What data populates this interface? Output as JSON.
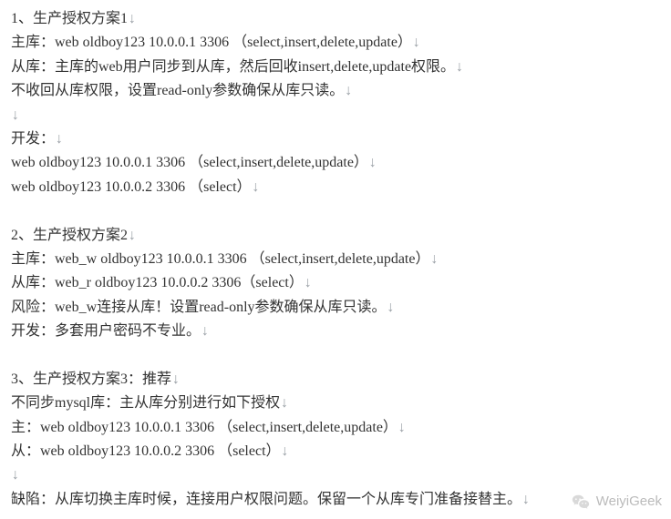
{
  "ret": "↓",
  "lines": [
    {
      "text": "1、生产授权方案1"
    },
    {
      "text": "主库：web oldboy123 10.0.0.1 3306 （select,insert,delete,update）"
    },
    {
      "text": "从库：主库的web用户同步到从库，然后回收insert,delete,update权限。"
    },
    {
      "text": "不收回从库权限，设置read-only参数确保从库只读。"
    },
    {
      "text": ""
    },
    {
      "text": "开发："
    },
    {
      "text": "web oldboy123 10.0.0.1 3306 （select,insert,delete,update）"
    },
    {
      "text": "web oldboy123 10.0.0.2 3306 （select）"
    },
    {
      "blank": true
    },
    {
      "text": "2、生产授权方案2"
    },
    {
      "text": "主库：web_w oldboy123 10.0.0.1 3306 （select,insert,delete,update）"
    },
    {
      "text": "从库：web_r oldboy123 10.0.0.2 3306（select）"
    },
    {
      "text": "风险：web_w连接从库！设置read-only参数确保从库只读。"
    },
    {
      "text": "开发：多套用户密码不专业。"
    },
    {
      "blank": true
    },
    {
      "text": "3、生产授权方案3：推荐"
    },
    {
      "text": "不同步mysql库：主从库分别进行如下授权"
    },
    {
      "text": "主：web oldboy123 10.0.0.1 3306 （select,insert,delete,update）"
    },
    {
      "text": "从：web oldboy123 10.0.0.2 3306 （select）"
    },
    {
      "text": ""
    },
    {
      "text": "缺陷：从库切换主库时候，连接用户权限问题。保留一个从库专门准备接替主。"
    }
  ],
  "watermark": "WeiyiGeek"
}
